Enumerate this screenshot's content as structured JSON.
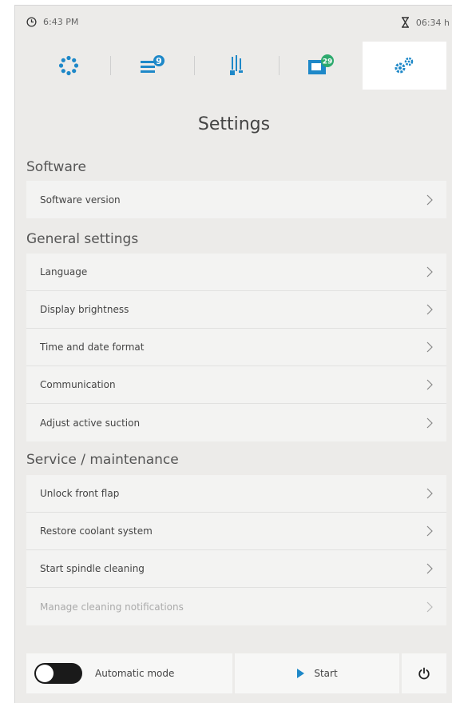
{
  "status": {
    "clock_time": "6:43 PM",
    "run_time": "06:34 h",
    "clock_icon": "clock-icon",
    "timer_icon": "hourglass-icon"
  },
  "tabs": [
    {
      "icon": "spinner-dots-icon",
      "badge": ""
    },
    {
      "icon": "list-queue-icon",
      "badge": "9"
    },
    {
      "icon": "tools-icon",
      "badge": ""
    },
    {
      "icon": "machine-icon",
      "badge": "29"
    },
    {
      "icon": "gears-icon",
      "badge": "",
      "active": true
    }
  ],
  "page": {
    "title": "Settings"
  },
  "sections": {
    "software": {
      "title": "Software",
      "items": [
        "Software version"
      ]
    },
    "general": {
      "title": "General settings",
      "items": [
        "Language",
        "Display brightness",
        "Time and date format",
        "Communication",
        "Adjust active suction"
      ]
    },
    "service": {
      "title": "Service / maintenance",
      "items": [
        "Unlock front flap",
        "Restore coolant system",
        "Start spindle cleaning",
        "Manage cleaning notifications"
      ]
    }
  },
  "bottom": {
    "mode_label": "Automatic mode",
    "start_label": "Start",
    "power_icon": "power-icon"
  },
  "colors": {
    "accent_blue": "#1e88c8",
    "badge_green": "#2eaa6e",
    "background": "#ecebe9"
  }
}
